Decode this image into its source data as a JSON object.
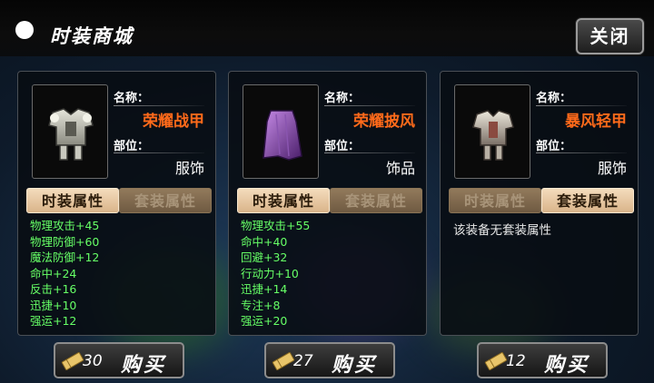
{
  "header": {
    "title": "时装商城",
    "close_label": "关闭"
  },
  "labels": {
    "name": "名称：",
    "slot": "部位："
  },
  "items": [
    {
      "name": "荣耀战甲",
      "slot": "服饰",
      "tabs": [
        "时装属性",
        "套装属性"
      ],
      "active_tab": 0,
      "icon": "silver-armor-icon",
      "stats": [
        "物理攻击+45",
        "物理防御+60",
        "魔法防御+12",
        "命中+24",
        "反击+16",
        "迅捷+10",
        "强运+12"
      ],
      "price": "30",
      "buy_label": "购买"
    },
    {
      "name": "荣耀披风",
      "slot": "饰品",
      "tabs": [
        "时装属性",
        "套装属性"
      ],
      "active_tab": 0,
      "icon": "purple-cape-icon",
      "stats": [
        "物理攻击+55",
        "命中+40",
        "回避+32",
        "行动力+10",
        "迅捷+14",
        "专注+8",
        "强运+20"
      ],
      "price": "27",
      "buy_label": "购买"
    },
    {
      "name": "暴风轻甲",
      "slot": "服饰",
      "tabs": [
        "时装属性",
        "套装属性"
      ],
      "active_tab": 1,
      "icon": "light-armor-icon",
      "no_set_text": "该装备无套装属性",
      "price": "12",
      "buy_label": "购买"
    }
  ],
  "colors": {
    "item_name": "#ff6a1a",
    "stat_text": "#66ff66",
    "active_tab": "#f4dcbc",
    "inactive_tab": "#927a5c"
  }
}
